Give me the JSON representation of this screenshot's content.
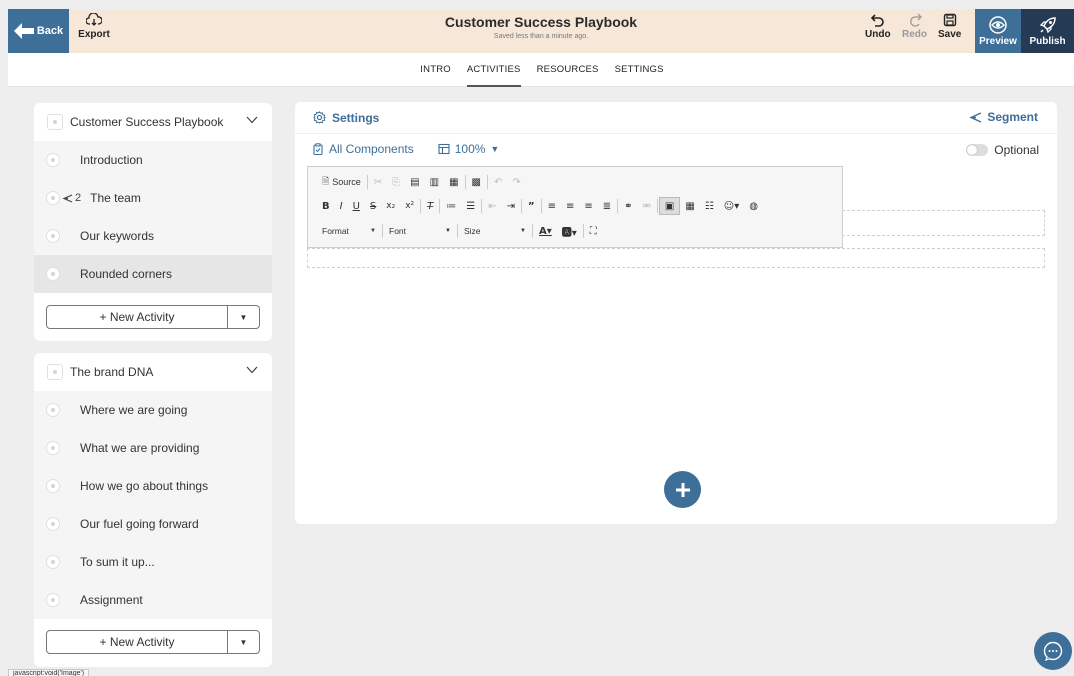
{
  "header": {
    "back_label": "Back",
    "export_label": "Export",
    "title": "Customer Success Playbook",
    "subtitle": "Saved less than a minute ago.",
    "undo_label": "Undo",
    "redo_label": "Redo",
    "save_label": "Save",
    "preview_label": "Preview",
    "publish_label": "Publish"
  },
  "nav": {
    "tabs": [
      {
        "label": "INTRO"
      },
      {
        "label": "ACTIVITIES"
      },
      {
        "label": "RESOURCES"
      },
      {
        "label": "SETTINGS"
      }
    ],
    "active_tab": "ACTIVITIES"
  },
  "sidebar": {
    "sections": [
      {
        "title": "Customer Success Playbook",
        "items": [
          {
            "label": "Introduction"
          },
          {
            "label": "The team",
            "segment_count": "2"
          },
          {
            "label": "Our keywords"
          },
          {
            "label": "Rounded corners",
            "selected": true
          }
        ],
        "new_activity_label": "+ New Activity"
      },
      {
        "title": "The brand DNA",
        "items": [
          {
            "label": "Where we are going"
          },
          {
            "label": "What we are providing"
          },
          {
            "label": "How we go about things"
          },
          {
            "label": "Our fuel going forward"
          },
          {
            "label": "To sum it up..."
          },
          {
            "label": "Assignment"
          }
        ],
        "new_activity_label": "+ New Activity"
      }
    ]
  },
  "main": {
    "settings_label": "Settings",
    "segment_label": "Segment",
    "all_components_label": "All Components",
    "zoom_label": "100%",
    "optional_label": "Optional"
  },
  "editor": {
    "source_label": "Source",
    "format_label": "Format",
    "font_label": "Font",
    "size_label": "Size"
  },
  "status_bar": {
    "text": "javascript:void('Image')"
  },
  "colors": {
    "primary": "#3d6f99",
    "publish": "#253a54",
    "header_bg": "#f7e7d8",
    "page_bg": "#eeeeee"
  }
}
